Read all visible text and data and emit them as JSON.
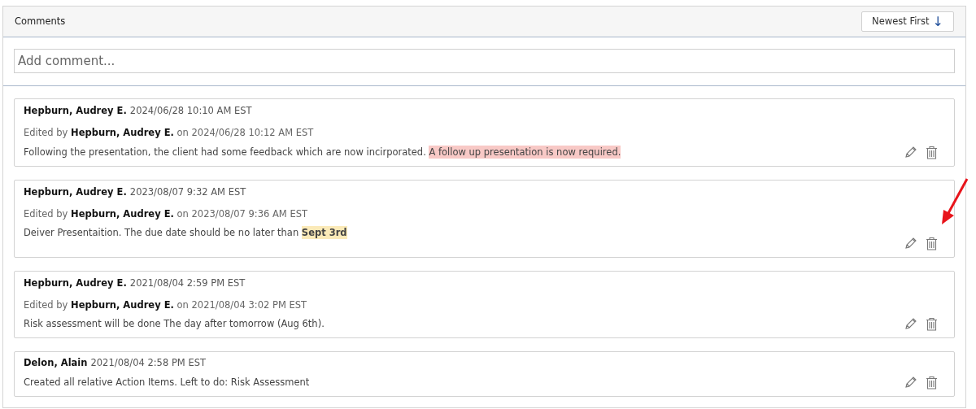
{
  "panel": {
    "title": "Comments",
    "sort_button": {
      "label": "Newest First",
      "arrow": "↓"
    }
  },
  "new_comment": {
    "placeholder": "Add comment..."
  },
  "comments": [
    {
      "author": "Hepburn, Audrey E.",
      "timestamp": "2024/06/28 10:10 AM EST",
      "edited": {
        "prefix": "Edited by",
        "editor": "Hepburn, Audrey E.",
        "suffix": "on 2024/06/28 10:12 AM EST"
      },
      "body": [
        {
          "text": "Following the presentation, the client had some feedback which are now incirporated. "
        },
        {
          "text": "A follow up presentation is now required.",
          "color": "#f8c9c6"
        }
      ],
      "annotated": false
    },
    {
      "author": "Hepburn, Audrey E.",
      "timestamp": "2023/08/07 9:32 AM EST",
      "edited": {
        "prefix": "Edited by",
        "editor": "Hepburn, Audrey E.",
        "suffix": "on 2023/08/07 9:36 AM EST"
      },
      "body": [
        {
          "text": "Deiver Presentaition. The due date should be no later than "
        },
        {
          "text": "Sept 3rd",
          "color": "#fbeab8",
          "bold": true
        }
      ],
      "annotated": true
    },
    {
      "author": "Hepburn, Audrey E.",
      "timestamp": "2021/08/04 2:59 PM EST",
      "edited": {
        "prefix": "Edited by",
        "editor": "Hepburn, Audrey E.",
        "suffix": "on 2021/08/04 3:02 PM EST"
      },
      "body": [
        {
          "text": "Risk assessment will be done The day after tomorrow (Aug 6th)."
        }
      ],
      "annotated": false
    },
    {
      "author": "Delon, Alain",
      "timestamp": "2021/08/04 2:58 PM EST",
      "body": [
        {
          "text": "Created all relative Action Items. Left to do: Risk Assessment"
        }
      ],
      "annotated": false
    }
  ]
}
